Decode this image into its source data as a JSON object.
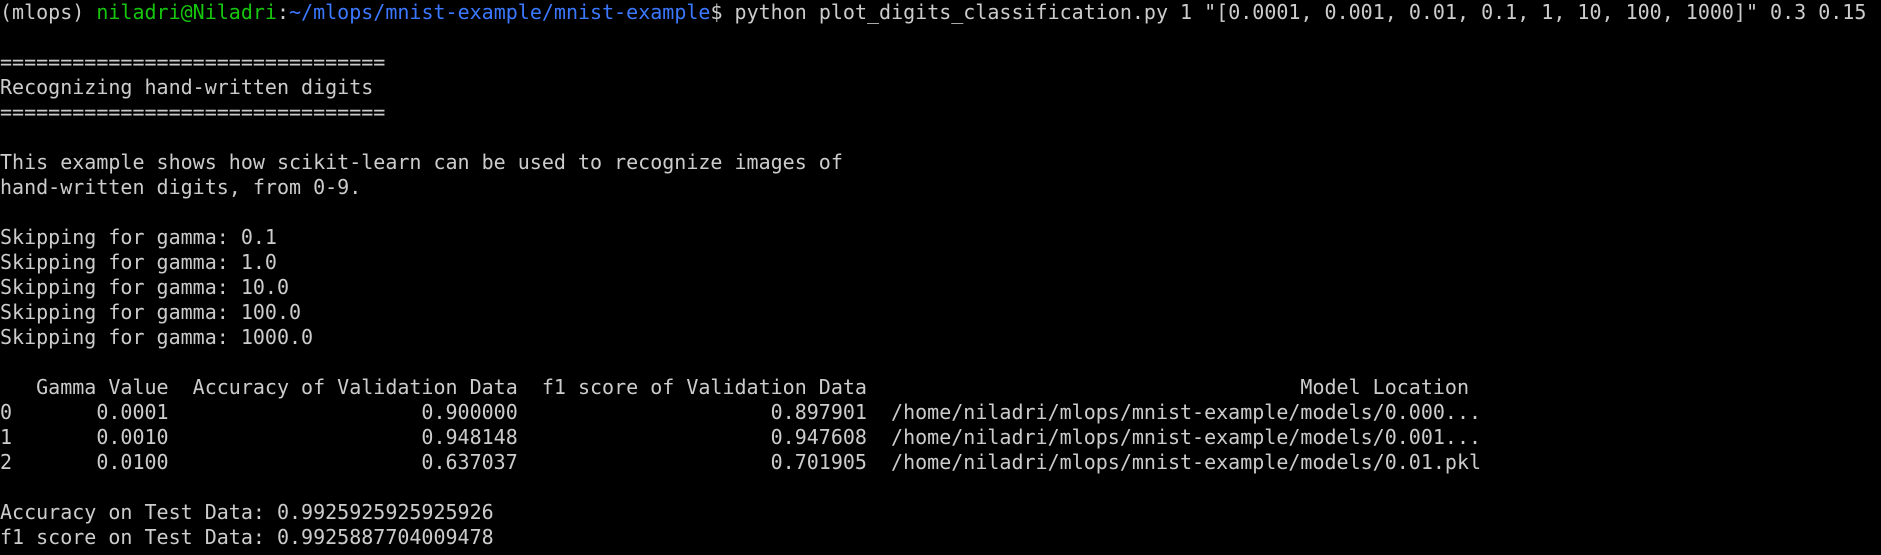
{
  "prompt": {
    "env": "(mlops) ",
    "user_host": "niladri@Niladri",
    "separator": ":",
    "path": "~/mlops/mnist-example/mnist-example",
    "symbol": "$ ",
    "command": "python plot_digits_classification.py 1 \"[0.0001, 0.001, 0.01, 0.1, 1, 10, 100, 1000]\" 0.3 0.15"
  },
  "output": {
    "rule": "================================",
    "heading": "Recognizing hand-written digits",
    "description": [
      "This example shows how scikit-learn can be used to recognize images of",
      "hand-written digits, from 0-9."
    ],
    "skips": [
      "Skipping for gamma: 0.1",
      "Skipping for gamma: 1.0",
      "Skipping for gamma: 10.0",
      "Skipping for gamma: 100.0",
      "Skipping for gamma: 1000.0"
    ],
    "table": {
      "header": "   Gamma Value  Accuracy of Validation Data  f1 score of Validation Data                                    Model Location",
      "rows": [
        "0       0.0001                     0.900000                     0.897901  /home/niladri/mlops/mnist-example/models/0.000...",
        "1       0.0010                     0.948148                     0.947608  /home/niladri/mlops/mnist-example/models/0.001...",
        "2       0.0100                     0.637037                     0.701905  /home/niladri/mlops/mnist-example/models/0.01.pkl"
      ]
    },
    "test_accuracy": "Accuracy on Test Data: 0.9925925925925926",
    "test_f1": "f1 score on Test Data: 0.9925887704009478"
  },
  "colors": {
    "background": "#000000",
    "text": "#cccccc",
    "user_host": "#16c60c",
    "path": "#3b78ff"
  }
}
